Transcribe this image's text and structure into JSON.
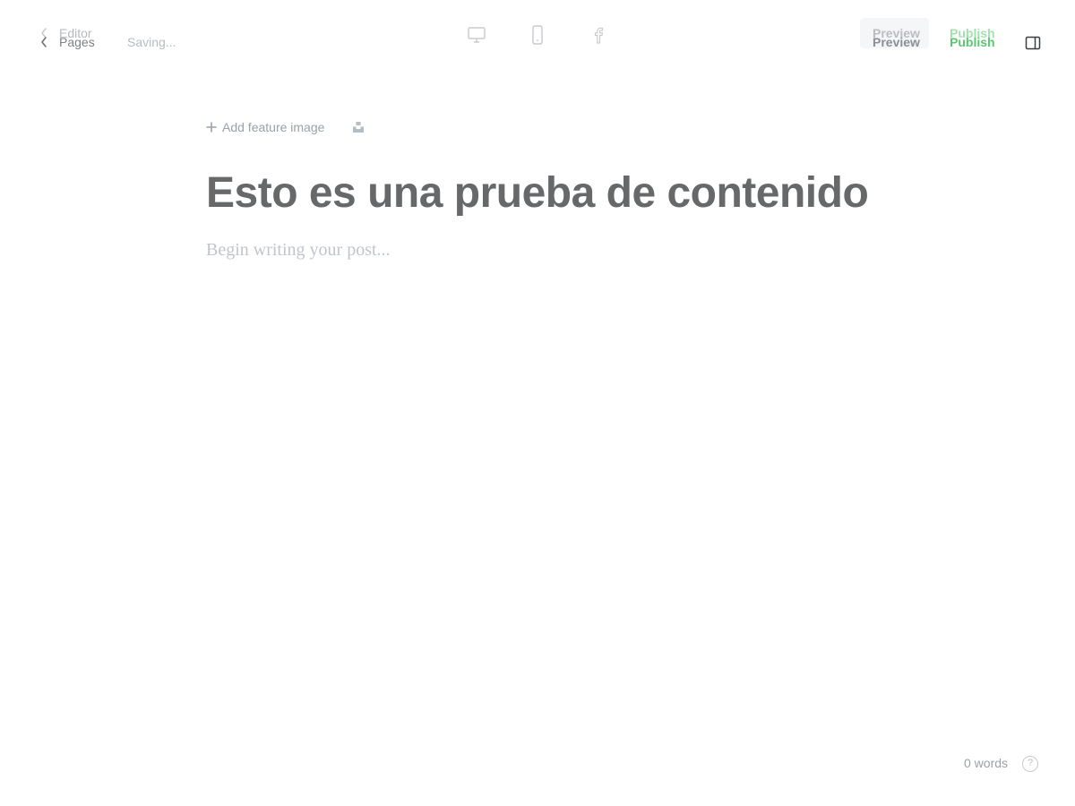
{
  "header": {
    "back_ghost_label": "Editor",
    "back_label": "Pages",
    "status_text": "Saving...",
    "preview_label": "Preview",
    "publish_label": "Publish",
    "device_icons": [
      "desktop-icon",
      "mobile-icon",
      "facebook-icon"
    ],
    "sidebar_icon": "sidebar-toggle-icon"
  },
  "editor": {
    "add_feature_image_label": "Add feature image",
    "title": "Esto es una prueba de contenido",
    "body_placeholder": "Begin writing your post..."
  },
  "footer": {
    "word_count": "0 words",
    "help_label": "?"
  },
  "colors": {
    "accent_green": "#58c86f",
    "title_gray": "#66686a",
    "placeholder_gray": "#c0c5cb"
  }
}
